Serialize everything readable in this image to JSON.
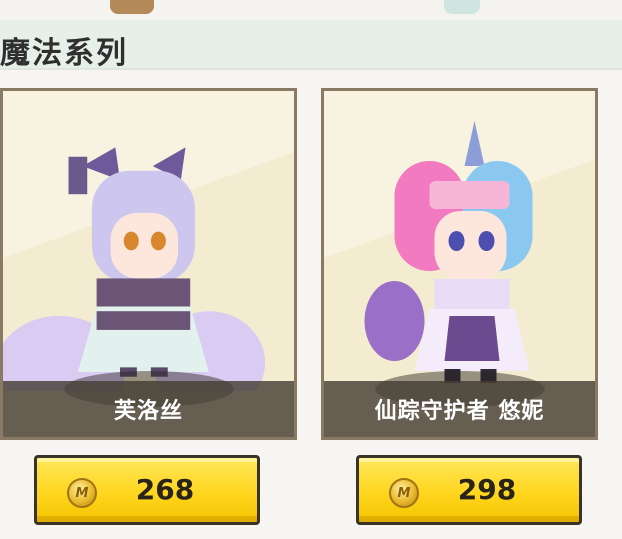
{
  "section": {
    "title": "魔法系列"
  },
  "items": [
    {
      "name": "芙洛丝",
      "price": "268",
      "coin_icon": "gold-coin-icon",
      "coin_letter": "M"
    },
    {
      "name": "仙踪守护者 悠妮",
      "price": "298",
      "coin_icon": "gold-coin-icon",
      "coin_letter": "M"
    }
  ],
  "colors": {
    "header_bg": "#e7efe9",
    "card_bg": "#f4ecd0",
    "card_border": "#8b7a63",
    "button_yellow": "#ffd61f",
    "name_bar": "#463e34"
  }
}
